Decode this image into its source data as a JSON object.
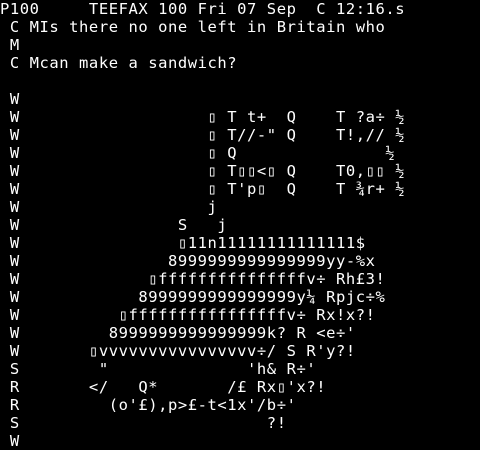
{
  "colors": {
    "background": "#000000",
    "text": "#ffffff"
  },
  "header": {
    "text": "P100     TEEFAX 100 Fri 07 Sep  C 12:16.s"
  },
  "lines": [
    " C MIs there no one left in Britain who",
    " M",
    " C Mcan make a sandwich?",
    "",
    " W",
    " W                   ▯ T t+  Q    T ?a÷ ½",
    " W                   ▯ T//-\" Q    T!,// ½",
    " W                   ▯ Q               ½",
    " W                   ▯ T▯▯<▯ Q    T0,▯▯ ½",
    " W                   ▯ T'p▯  Q    T ¾r+ ½",
    " W                   j",
    " W                S   j",
    " W                ▯11n11111111111111$",
    " W               8999999999999999yy-%x",
    " W             ▯fffffffffffffffv÷ Rh£3!",
    " W            8999999999999999y¼ Rpjc÷%",
    " W          ▯ffffffffffffffffv÷ Rx!x?!",
    " W         8999999999999999k? R <e÷'",
    " W       ▯vvvvvvvvvvvvvvvv÷/ S R'y?!",
    " S        \"              'h& R÷'",
    " R       </   Q*       /£ Rx▯'x?!",
    " R         (o'£),p>£-t<1x'/b÷'",
    " S                         ?!",
    " W"
  ]
}
